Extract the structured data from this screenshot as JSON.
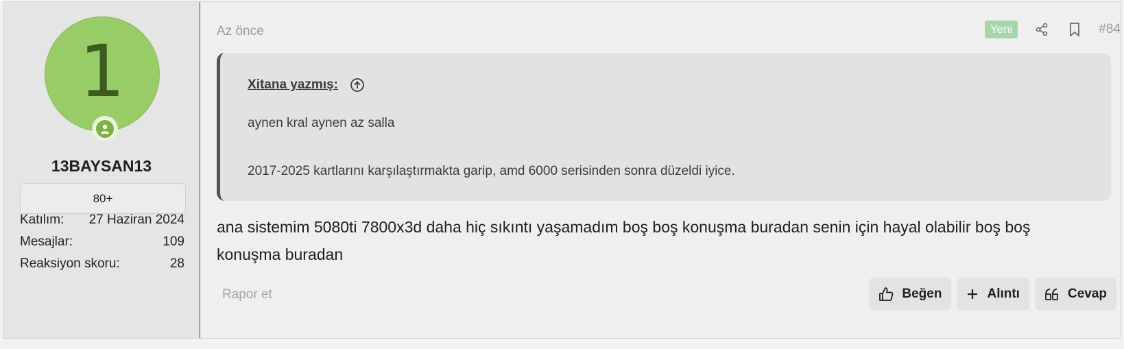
{
  "user": {
    "avatar_letter": "1",
    "username": "13BAYSAN13",
    "badge": "80+",
    "stats": [
      {
        "label": "Katılım:",
        "value": "27 Haziran 2024"
      },
      {
        "label": "Mesajlar:",
        "value": "109"
      },
      {
        "label": "Reaksiyon skoru:",
        "value": "28"
      }
    ]
  },
  "post": {
    "timestamp": "Az önce",
    "new_badge": "Yeni",
    "number": "#84",
    "quote": {
      "author": "Xitana yazmış:",
      "lines": [
        "aynen kral aynen az salla",
        "2017-2025 kartlarını karşılaştırmakta garip, amd 6000 serisinden sonra düzeldi iyice."
      ]
    },
    "body": "ana sistemim 5080ti 7800x3d daha hiç sıkıntı yaşamadım boş boş konuşma buradan senin için hayal olabilir boş boş konuşma buradan",
    "report": "Rapor et",
    "actions": {
      "like": "Beğen",
      "quote": "Alıntı",
      "reply": "Cevap"
    }
  },
  "colors": {
    "avatar": "#98cc66",
    "new_badge": "#a5d6a7",
    "quote_border": "#4e5360"
  }
}
